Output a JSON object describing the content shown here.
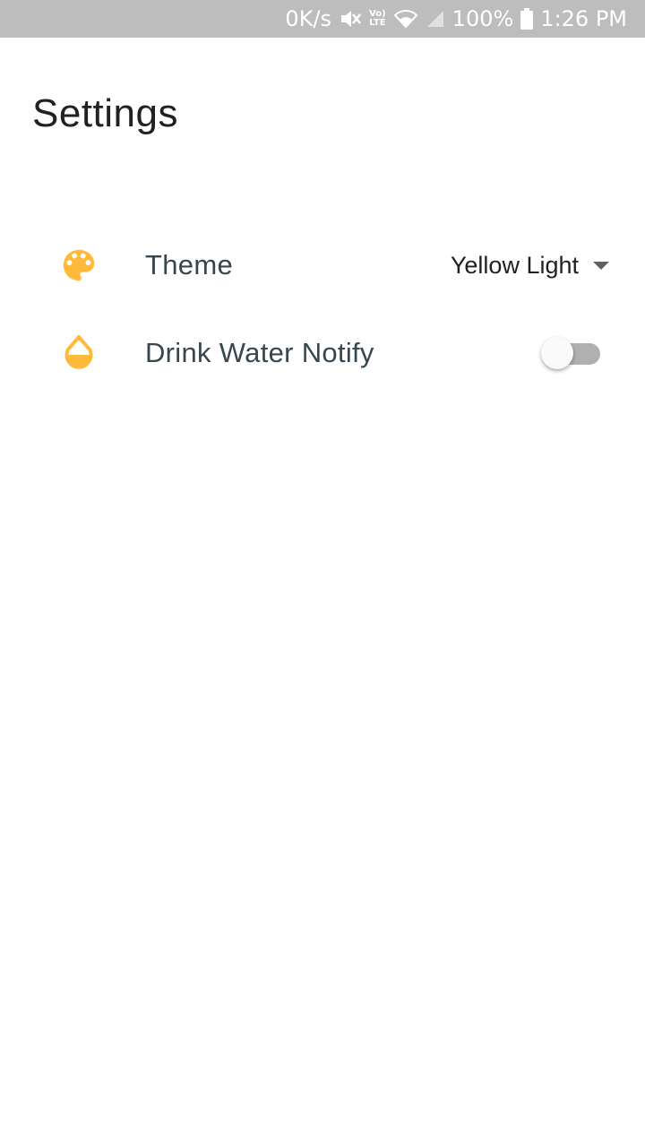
{
  "status_bar": {
    "net_speed": "0K/s",
    "lte_top": "Vo)",
    "lte_bottom": "LTE",
    "battery": "100%",
    "time": "1:26 PM"
  },
  "header": {
    "title": "Settings"
  },
  "settings": {
    "theme": {
      "label": "Theme",
      "value": "Yellow Light",
      "icon": "palette-icon"
    },
    "water": {
      "label": "Drink Water Notify",
      "enabled": false,
      "icon": "water-drop-icon"
    }
  },
  "colors": {
    "accent": "#FFBA3B",
    "status_bar": "#BDBDBD",
    "label": "#37474F"
  }
}
